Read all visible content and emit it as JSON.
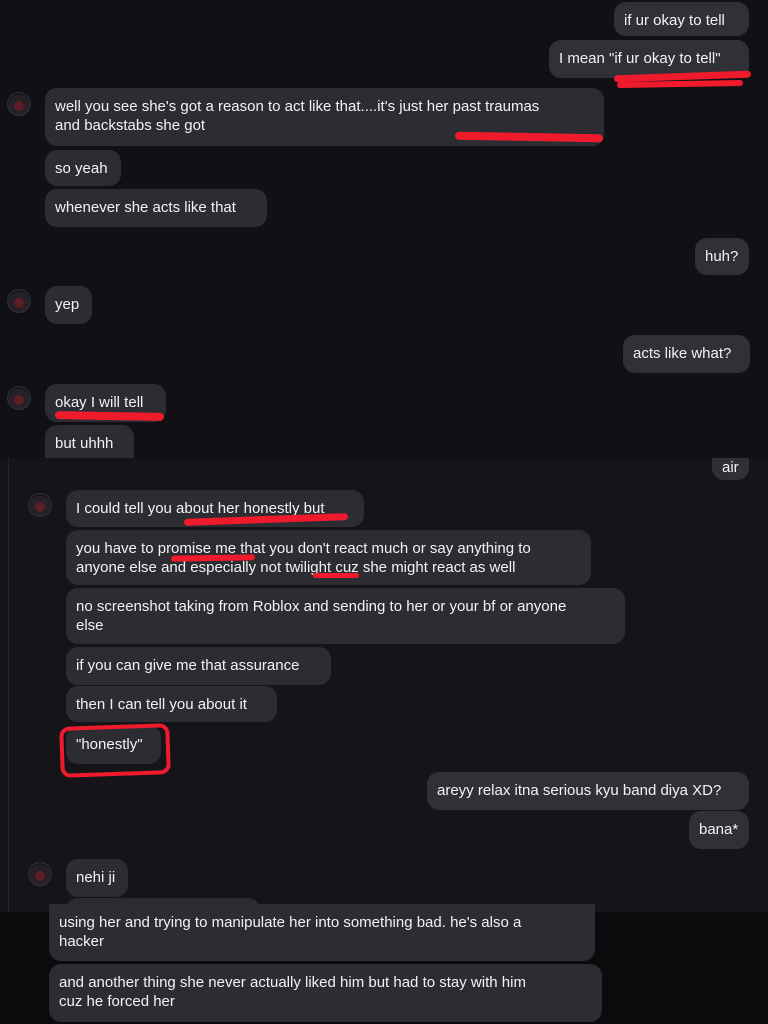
{
  "messages": {
    "m1": "if ur okay to tell",
    "m2": "I mean \"if ur okay to tell\"",
    "m3_line1": "well you see she's got a reason to act like that....it's just her past traumas",
    "m3_line2": "and backstabs she got",
    "m4": "so yeah",
    "m5": "whenever she acts like that",
    "m6": "huh?",
    "m7": "yep",
    "m8": "acts like what?",
    "m9": "okay I will tell",
    "m10": "but uhhh",
    "m11": "air",
    "m12": "I could tell you about her honestly but",
    "m13_line1": "you have to promise me that you don't react much or say anything to",
    "m13_line2": "anyone else and especially not twilight cuz she might react as well",
    "m14_line1": "no screenshot taking from Roblox and sending to her or your bf or anyone",
    "m14_line2": "else",
    "m15": "if you can give me that assurance",
    "m16": "then I can tell you about it",
    "m17": "\"honestly\"",
    "m18": "areyy relax itna serious kyu band diya XD?",
    "m19": "bana*",
    "m20": "nehi ji",
    "m21_line1": "using her and trying to manipulate her into something bad. he's also a",
    "m21_line2": "hacker",
    "m22_line1": "and another thing she never actually liked him but had to stay with him",
    "m22_line2": "cuz he forced her"
  },
  "colors": {
    "background": "#0f1014",
    "incoming_bubble": "#2b2d33",
    "outgoing_bubble": "#2f3137",
    "text": "#f2f3f5",
    "annotation": "#ef1b2d"
  },
  "icons": {
    "avatar": "dark-red-profile-avatar-icon"
  }
}
